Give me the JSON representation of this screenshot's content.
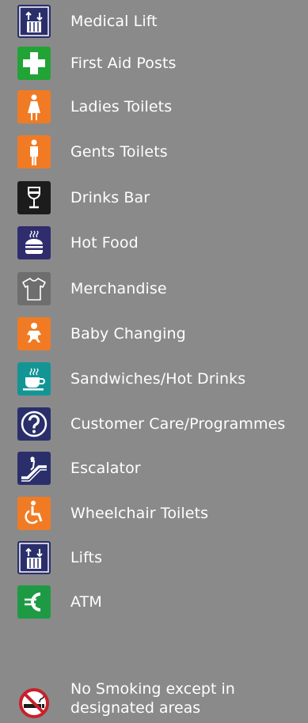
{
  "legend": [
    {
      "key": "medical-lift",
      "label": "Medical Lift",
      "color": "#2a2f6b",
      "icon": "lift-icon"
    },
    {
      "key": "first-aid",
      "label": "First Aid Posts",
      "color": "#21a336",
      "icon": "first-aid-cross-icon"
    },
    {
      "key": "ladies-toilets",
      "label": "Ladies Toilets",
      "color": "#f07b24",
      "icon": "woman-icon"
    },
    {
      "key": "gents-toilets",
      "label": "Gents Toilets",
      "color": "#f07b24",
      "icon": "man-icon"
    },
    {
      "key": "drinks-bar",
      "label": "Drinks Bar",
      "color": "#1c1c1c",
      "icon": "wine-glass-icon"
    },
    {
      "key": "hot-food",
      "label": "Hot Food",
      "color": "#2f2d6e",
      "icon": "burger-icon"
    },
    {
      "key": "merchandise",
      "label": "Merchandise",
      "color": "#6e6e6e",
      "icon": "tshirt-icon"
    },
    {
      "key": "baby-changing",
      "label": "Baby Changing",
      "color": "#f07b24",
      "icon": "baby-icon"
    },
    {
      "key": "sandwiches-hot-drinks",
      "label": "Sandwiches/Hot Drinks",
      "color": "#139595",
      "icon": "coffee-cup-icon"
    },
    {
      "key": "customer-care",
      "label": "Customer Care/Programmes",
      "color": "#2a2f6b",
      "icon": "question-mark-icon"
    },
    {
      "key": "escalator",
      "label": "Escalator",
      "color": "#2a2f6b",
      "icon": "escalator-icon"
    },
    {
      "key": "wheelchair-toilets",
      "label": "Wheelchair Toilets",
      "color": "#f07b24",
      "icon": "wheelchair-icon"
    },
    {
      "key": "lifts",
      "label": "Lifts",
      "color": "#2a2f6b",
      "icon": "lift-icon"
    },
    {
      "key": "atm",
      "label": "ATM",
      "color": "#1e9a45",
      "icon": "euro-icon"
    }
  ],
  "note": {
    "label": "No Smoking except in designated areas",
    "icon": "no-smoking-icon",
    "color": "#c8202a"
  }
}
